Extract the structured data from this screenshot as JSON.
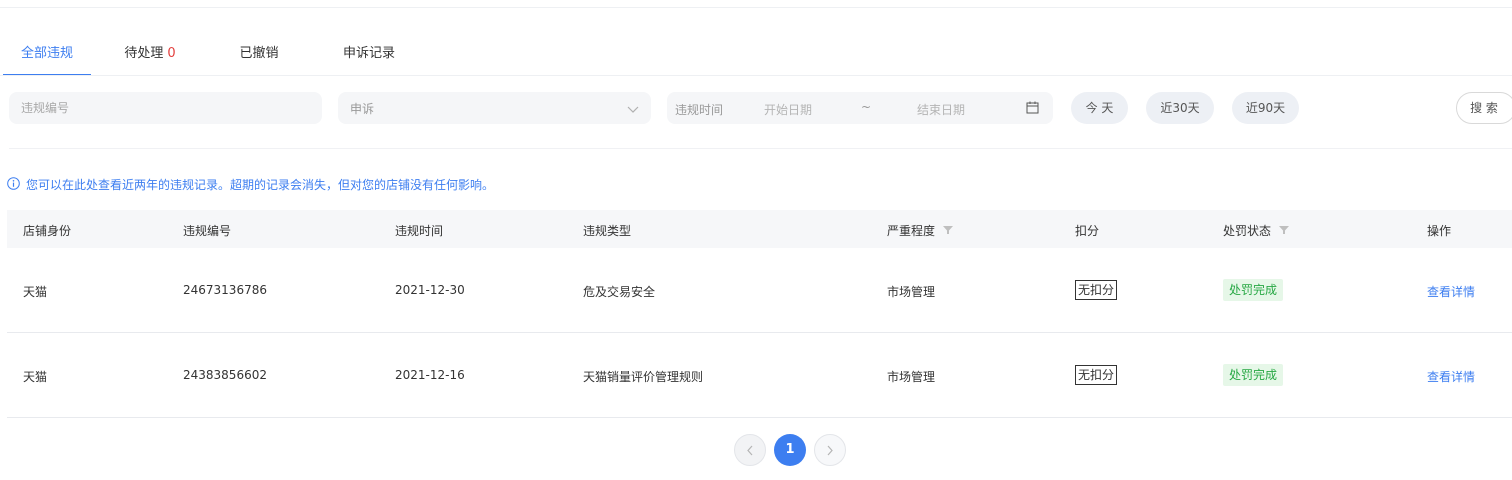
{
  "tabs": [
    {
      "label": "全部违规",
      "active": true
    },
    {
      "label": "待处理",
      "count": "0"
    },
    {
      "label": "已撤销"
    },
    {
      "label": "申诉记录"
    }
  ],
  "filters": {
    "code_placeholder": "违规编号",
    "appeal_value": "申诉",
    "date_label": "违规时间",
    "start_placeholder": "开始日期",
    "separator": "~",
    "end_placeholder": "结束日期",
    "quick": [
      "今 天",
      "近30天",
      "近90天"
    ],
    "search_label": "搜 索"
  },
  "notice": "您可以在此处查看近两年的违规记录。超期的记录会消失，但对您的店铺没有任何影响。",
  "table": {
    "columns": [
      "店铺身份",
      "违规编号",
      "违规时间",
      "违规类型",
      "严重程度",
      "扣分",
      "处罚状态",
      "操作"
    ],
    "rows": [
      {
        "shop": "天猫",
        "code": "24673136786",
        "time": "2021-12-30",
        "type": "危及交易安全",
        "severity": "市场管理",
        "points": "无扣分",
        "status": "处罚完成",
        "action": "查看详情"
      },
      {
        "shop": "天猫",
        "code": "24383856602",
        "time": "2021-12-16",
        "type": "天猫销量评价管理规则",
        "severity": "市场管理",
        "points": "无扣分",
        "status": "处罚完成",
        "action": "查看详情"
      }
    ]
  },
  "pagination": {
    "current": "1"
  },
  "colors": {
    "accent": "#3d7ef0",
    "danger": "#e3413f",
    "success": "#27a844",
    "success_bg": "#e6f7e8"
  },
  "icons": [
    "chevron-down-icon",
    "calendar-icon",
    "info-icon",
    "filter-icon",
    "chevron-left-icon",
    "chevron-right-icon"
  ]
}
